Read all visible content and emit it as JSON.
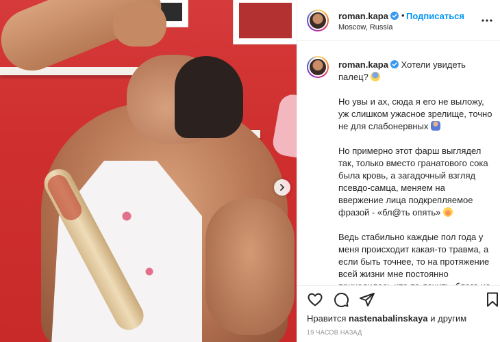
{
  "post": {
    "username": "roman.kapa",
    "dot": "•",
    "follow_label": "Подписаться",
    "location": "Moscow, Russia"
  },
  "caption": {
    "username": "roman.kapa",
    "p1": "Хотели увидеть палец? ",
    "p2": "Но увы и ах, сюда я его не выложу, уж слишком ужасное зрелище, точно не для слабонервных ",
    "p3": "Но примерно этот фарш выглядел так, только вместо гранатового сока была кровь, а загадочный взгляд псевдо-самца, меняем на ввержение лица подкрепляемое фразой - «бл@ть опять» ",
    "p4": "Ведь стабильно каждые пол года у меня происходит какая-то травма, а если быть точнее, то на протяжение всей жизни мне постоянно приходилось что-то лечить, благо не голову "
  },
  "likes": {
    "prefix": "Нравится",
    "user": "nastenabalinskaya",
    "suffix": "и другим"
  },
  "timestamp": "19 ЧАСОВ НАЗАД",
  "icons": {
    "verified": "verified-badge-icon",
    "more": "more-options-icon",
    "like": "heart-icon",
    "comment": "comment-icon",
    "share": "paper-plane-icon",
    "save": "bookmark-icon",
    "next": "chevron-right-icon"
  },
  "colors": {
    "accent": "#0095f6",
    "verified": "#3897f0",
    "border": "#efefef",
    "muted": "#8e8e8e"
  }
}
